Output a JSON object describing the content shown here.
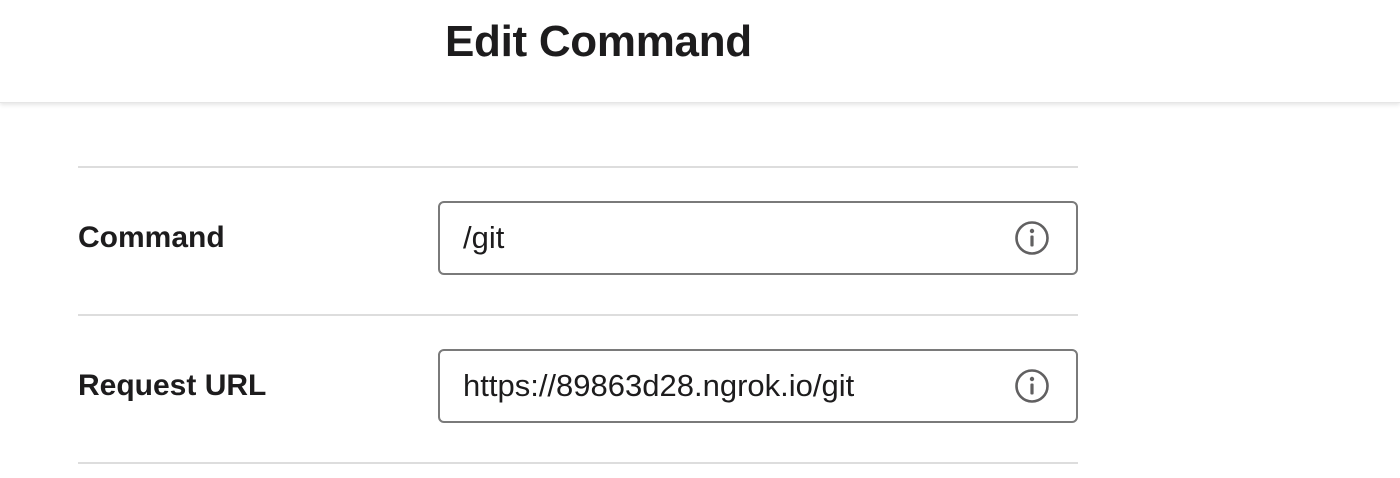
{
  "header": {
    "title": "Edit Command"
  },
  "form": {
    "fields": [
      {
        "label": "Command",
        "value": "/git",
        "icon": "info-icon"
      },
      {
        "label": "Request URL",
        "value": "https://89863d28.ngrok.io/git",
        "icon": "info-icon"
      }
    ]
  },
  "colors": {
    "text": "#1d1c1d",
    "input_border": "#7a7a7a",
    "divider": "#dddddd",
    "icon": "#616061"
  }
}
